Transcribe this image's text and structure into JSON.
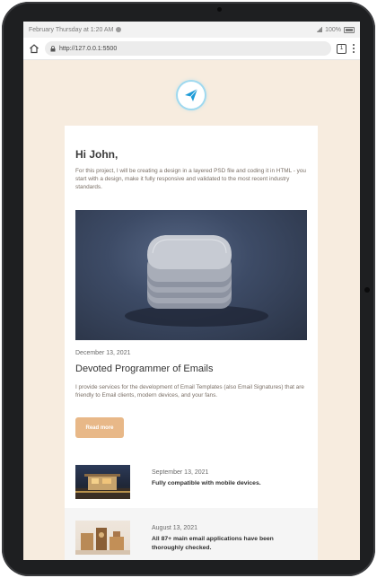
{
  "status_bar": {
    "datetime": "February Thursday at 1:20 AM",
    "battery": "100%"
  },
  "browser": {
    "url": "http://127.0.0.1:5500",
    "tab_count": "1"
  },
  "email": {
    "greeting": "Hi John,",
    "intro_text": "For this project, I will be creating a design in a layered PSD file and coding it in HTML - you start with a design, make it fully responsive and validated to the most recent industry standards.",
    "featured": {
      "date": "December 13, 2021",
      "title": "Devoted Programmer of Emails",
      "description": "I provide services for the development of Email Templates (also Email Signatures) that are friendly to Email clients, modern devices, and your fans.",
      "button_label": "Read more"
    },
    "list": [
      {
        "date": "September 13, 2021",
        "title": "Fully compatible with mobile devices."
      },
      {
        "date": "August 13, 2021",
        "title": "All 87+ main email applications have been thoroughly checked."
      }
    ]
  },
  "colors": {
    "page_background": "#f7ecdf",
    "accent_button": "#e8b888",
    "logo_blue": "#1e9bd7"
  },
  "icons": {
    "logo": "paper-plane-icon",
    "home": "home-icon",
    "lock": "lock-icon",
    "tabs": "tabs-icon",
    "menu": "kebab-menu-icon"
  }
}
